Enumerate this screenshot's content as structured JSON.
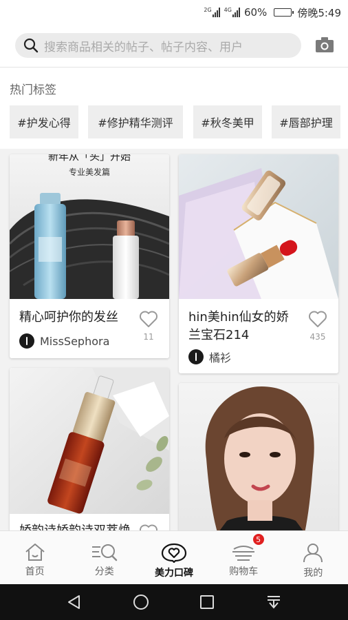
{
  "status_bar": {
    "net1": "2G",
    "net2": "4G",
    "battery_pct": "60%",
    "battery_level": 0.6,
    "time": "傍晚5:49"
  },
  "search": {
    "placeholder": "搜索商品相关的帖子、帖子内容、用户",
    "camera_icon": "camera-icon"
  },
  "hot_tags": {
    "title": "热门标签",
    "items": [
      "#护发心得",
      "#修护精华测评",
      "#秋冬美甲",
      "#唇部护理"
    ]
  },
  "posts": [
    {
      "image_caption_line1": "新年从「头」开始",
      "image_caption_line2": "专业美发篇",
      "title": "精心呵护你的发丝",
      "author": "MissSephora",
      "likes": "11"
    },
    {
      "title_line1": "hin美hin仙女的娇",
      "title_line2": "兰宝石214",
      "author": "橘衫",
      "likes": "435"
    },
    {
      "title_partial": "娇韵诗娇韵诗双萃焕"
    },
    {}
  ],
  "tabbar": {
    "items": [
      {
        "label": "首页",
        "icon": "home-icon"
      },
      {
        "label": "分类",
        "icon": "category-search-icon"
      },
      {
        "label": "美力口碑",
        "icon": "chat-heart-icon"
      },
      {
        "label": "购物车",
        "icon": "cart-icon",
        "badge": "5"
      },
      {
        "label": "我的",
        "icon": "user-icon"
      }
    ],
    "active": "美力口碑"
  },
  "nav_icons": [
    "back-icon",
    "home-circle-icon",
    "recent-apps-icon",
    "notification-pull-icon"
  ],
  "colors": {
    "badge": "#e02020",
    "lipstick_red": "#d4151c"
  }
}
